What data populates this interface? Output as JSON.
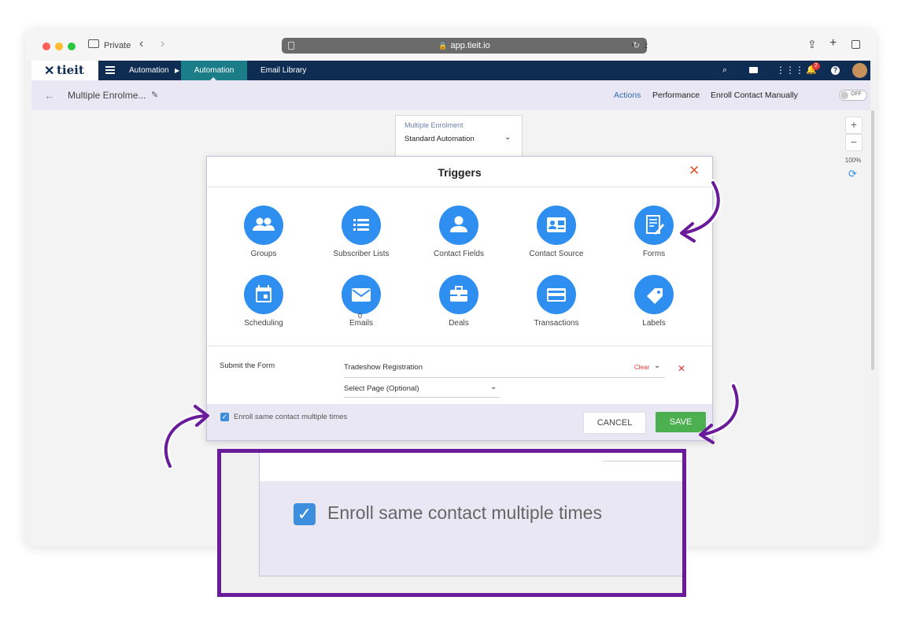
{
  "browser": {
    "private_label": "Private",
    "url": "app.tieit.io",
    "shield_count": "2"
  },
  "app": {
    "logo_text": "tieit",
    "nav_items": [
      "Automation",
      "Automation",
      "Email Library"
    ],
    "notification_count": "2"
  },
  "subheader": {
    "page_title": "Multiple Enrolme...",
    "actions": "Actions",
    "performance": "Performance",
    "enroll_manually": "Enroll Contact Manually",
    "toggle": "OFF"
  },
  "zoom": {
    "plus": "+",
    "minus": "−",
    "level": "100%"
  },
  "enrolment": {
    "label": "Multiple Enrolment",
    "value": "Standard Automation"
  },
  "modal": {
    "title": "Triggers",
    "triggers": [
      {
        "label": "Groups",
        "icon": "groups-icon"
      },
      {
        "label": "Subscriber Lists",
        "icon": "list-icon"
      },
      {
        "label": "Contact Fields",
        "icon": "person-icon"
      },
      {
        "label": "Contact Source",
        "icon": "contact-card-icon"
      },
      {
        "label": "Forms",
        "icon": "form-icon"
      },
      {
        "label": "Scheduling",
        "icon": "calendar-icon"
      },
      {
        "label": "Emails",
        "icon": "envelope-icon"
      },
      {
        "label": "Deals",
        "icon": "briefcase-icon"
      },
      {
        "label": "Transactions",
        "icon": "credit-card-icon"
      },
      {
        "label": "Labels",
        "icon": "tag-icon"
      }
    ],
    "emails_badge": "0",
    "condition_label": "Submit the Form",
    "form_value": "Tradeshow Registration",
    "clear_label": "Clear",
    "page_placeholder": "Select Page (Optional)",
    "checkbox_label": "Enroll same contact multiple times",
    "cancel": "CANCEL",
    "save": "SAVE"
  },
  "callout": {
    "checkbox_label": "Enroll same contact multiple times"
  },
  "colors": {
    "nav": "#0f2d52",
    "active_tab": "#1a7d88",
    "trigger_blue": "#2f8ff0",
    "save_green": "#4caf50",
    "annotation_purple": "#6a1b9a",
    "footer_lavender": "#e9e7f4"
  }
}
